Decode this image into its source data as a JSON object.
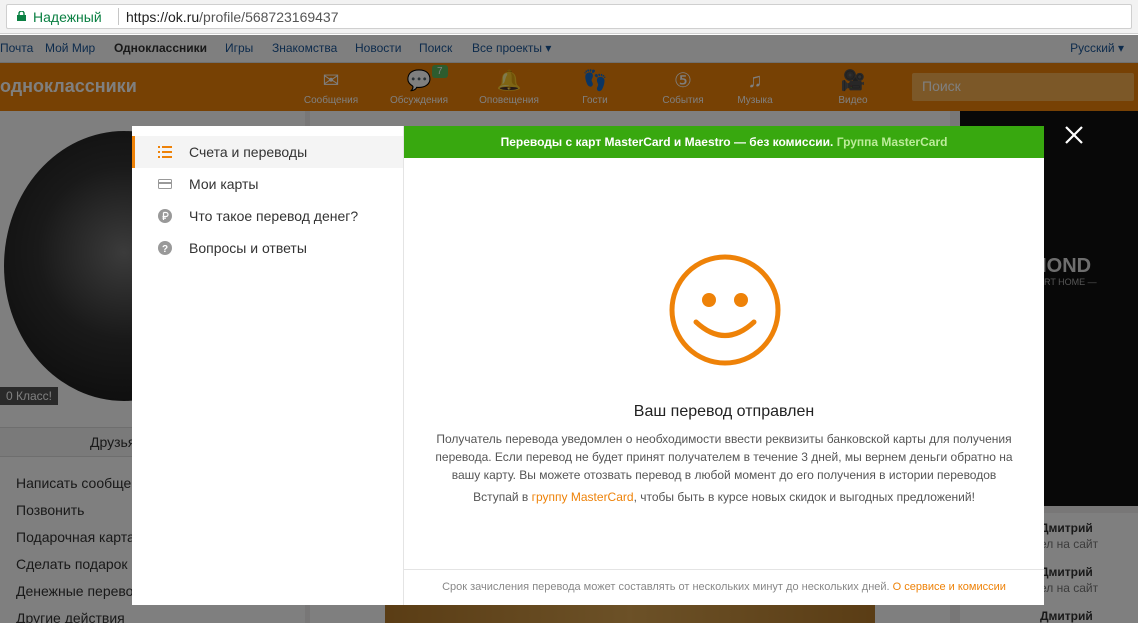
{
  "browser": {
    "secure_label": "Надежный",
    "url_scheme_host": "https://ok.ru",
    "url_path": "/profile/568723169437"
  },
  "site": {
    "topnav": [
      "Почта",
      "Мой Мир",
      "Одноклассники",
      "Игры",
      "Знакомства",
      "Новости",
      "Поиск",
      "Все проекты ▾"
    ],
    "language": "Русский ▾",
    "logo": "одноклассники",
    "nav_items": [
      {
        "label": "Сообщения",
        "icon": "envelope-icon",
        "glyph": "✉"
      },
      {
        "label": "Обсуждения",
        "icon": "chat-icon",
        "glyph": "💬",
        "badge": "7"
      },
      {
        "label": "Оповещения",
        "icon": "bell-icon",
        "glyph": "🔔"
      },
      {
        "label": "Гости",
        "icon": "footprints-icon",
        "glyph": "👣"
      },
      {
        "label": "События",
        "icon": "events-icon",
        "glyph": "⑤"
      },
      {
        "label": "Музыка",
        "icon": "music-icon",
        "glyph": "♫"
      },
      {
        "label": "Видео",
        "icon": "video-icon",
        "glyph": "🎥"
      }
    ],
    "search_placeholder": "Поиск",
    "avatar_caption": "0  Класс!",
    "friends_tab": "Друзья",
    "side_links": [
      "Написать сообщение",
      "Позвонить",
      "Подарочная карта",
      "Сделать подарок",
      "Денежные переводы",
      "Другие действия"
    ],
    "ad_brand": "MOND",
    "ad_sub": "ART HOME —",
    "right_friends": [
      {
        "name": "Дмитрий",
        "sub": "ел на сайт"
      },
      {
        "name": "Дмитрий",
        "sub": "ел на сайт"
      },
      {
        "name": "Дмитрий",
        "sub": ""
      }
    ]
  },
  "modal": {
    "menu": [
      {
        "label": "Счета и переводы",
        "icon": "list-icon",
        "active": true
      },
      {
        "label": "Мои карты",
        "icon": "card-icon",
        "active": false
      },
      {
        "label": "Что такое перевод денег?",
        "icon": "ruble-icon",
        "active": false
      },
      {
        "label": "Вопросы и ответы",
        "icon": "question-icon",
        "active": false
      }
    ],
    "promo_text": "Переводы с карт MasterCard и Maestro — без комиссии.",
    "promo_link": "Группа MasterCard",
    "success_title": "Ваш перевод отправлен",
    "success_text": "Получатель перевода уведомлен о необходимости ввести реквизиты банковской карты для получения перевода. Если перевод не будет принят получателем в течение 3 дней, мы вернем деньги обратно на вашу карту. Вы можете отозвать перевод в любой момент до его получения в истории переводов",
    "join_prefix": "Вступай в ",
    "join_link": "группу MasterCard",
    "join_suffix": ", чтобы быть в курсе новых скидок и выгодных предложений!",
    "footer_text": "Срок зачисления перевода может составлять от нескольких минут до нескольких дней. ",
    "footer_link": "О сервисе и комиссии",
    "accent_color": "#ee8208",
    "promo_color": "#38a80f"
  }
}
